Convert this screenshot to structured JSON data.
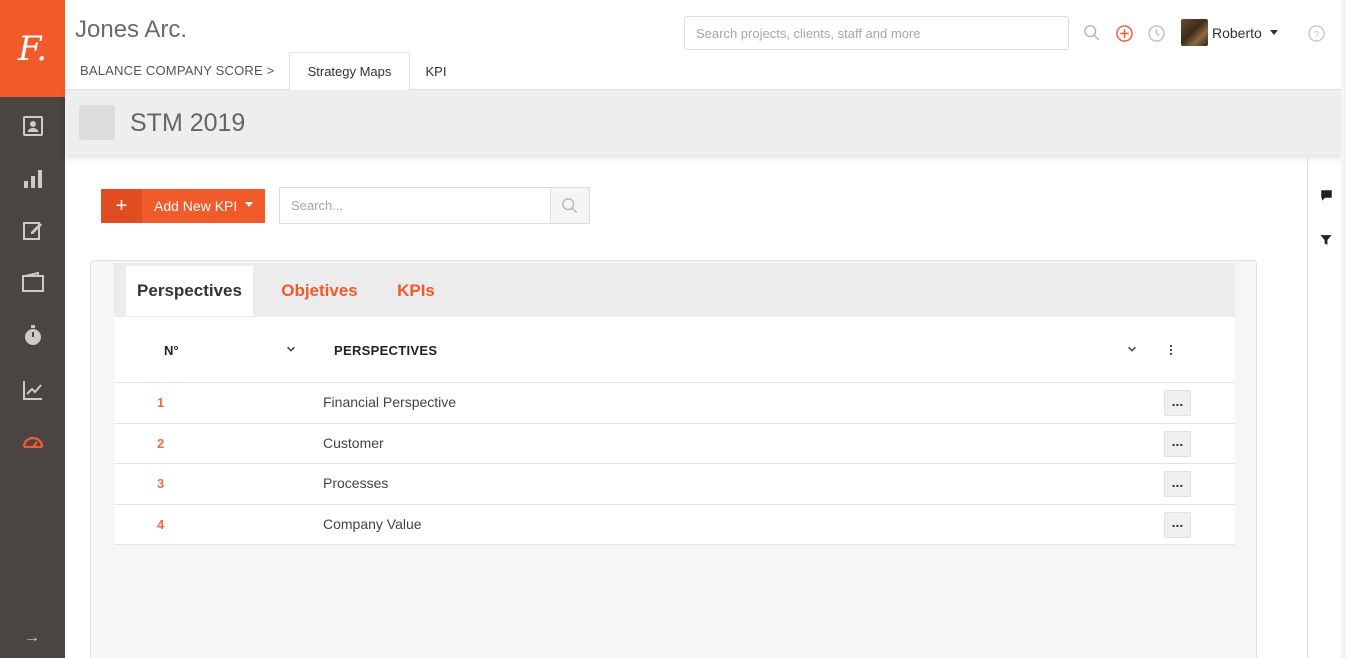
{
  "logo": {
    "text": "F."
  },
  "header": {
    "company": "Jones Arc.",
    "breadcrumb": "BALANCE COMPANY SCORE >",
    "tabs": [
      {
        "label": "Strategy Maps",
        "active": true
      },
      {
        "label": "KPI",
        "active": false
      }
    ],
    "search_placeholder": "Search projects, clients, staff and more",
    "user_name": "Roberto",
    "icons": [
      "search-icon",
      "add-circle-icon",
      "clock-icon",
      "help-icon"
    ]
  },
  "rail": {
    "items": [
      "contacts-icon",
      "bar-chart-icon",
      "edit-icon",
      "wallet-icon",
      "timer-icon",
      "line-chart-icon",
      "dashboard-icon"
    ],
    "active": "dashboard-icon",
    "expand_glyph": "→"
  },
  "page": {
    "title": "STM 2019"
  },
  "toolbar": {
    "add_plus": "+",
    "add_label": "Add New KPI",
    "search_placeholder": "Search..."
  },
  "panel": {
    "tabs": [
      {
        "label": "Perspectives",
        "active": true
      },
      {
        "label": "Objetives",
        "active": false
      },
      {
        "label": "KPIs",
        "active": false
      }
    ],
    "columns": {
      "no": "N°",
      "perspectives": "PERSPECTIVES"
    },
    "more_label": "...",
    "rows": [
      {
        "no": "1",
        "name": "Financial Perspective"
      },
      {
        "no": "2",
        "name": "Customer"
      },
      {
        "no": "3",
        "name": "Processes"
      },
      {
        "no": "4",
        "name": "Company Value"
      }
    ]
  },
  "colors": {
    "accent": "#f15a2b",
    "rail": "#4a4542",
    "number": "#f26b3d"
  }
}
